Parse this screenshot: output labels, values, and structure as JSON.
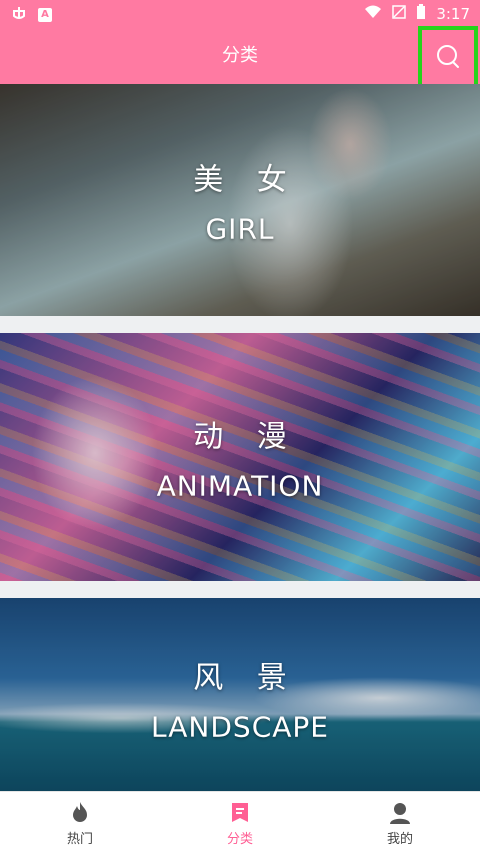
{
  "status": {
    "time": "3:17",
    "left_badge": "A"
  },
  "header": {
    "title": "分类"
  },
  "categories": [
    {
      "cn": "美 女",
      "en": "GIRL"
    },
    {
      "cn": "动 漫",
      "en": "ANIMATION"
    },
    {
      "cn": "风 景",
      "en": "LANDSCAPE"
    }
  ],
  "tabs": [
    {
      "label": "热门",
      "icon": "flame-icon",
      "active": false
    },
    {
      "label": "分类",
      "icon": "bookmark-list-icon",
      "active": true
    },
    {
      "label": "我的",
      "icon": "person-icon",
      "active": false
    }
  ],
  "colors": {
    "accent": "#ff7aa2",
    "active_tab": "#ff5f94",
    "highlight_box": "#25d41b"
  }
}
